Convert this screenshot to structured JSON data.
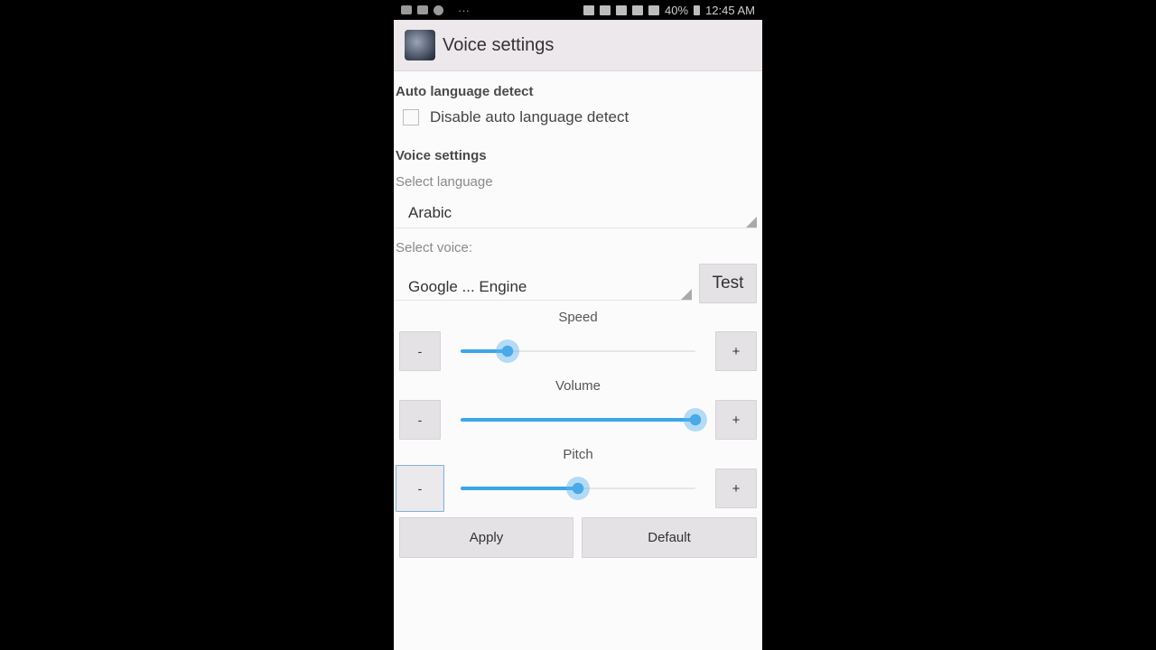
{
  "status_bar": {
    "battery": "40%",
    "time": "12:45 AM"
  },
  "app_bar": {
    "title": "Voice settings"
  },
  "auto_language": {
    "header": "Auto language detect",
    "checkbox_label": "Disable auto language detect",
    "checked": false
  },
  "voice": {
    "header": "Voice settings",
    "language_label": "Select language",
    "language_value": "Arabic",
    "voice_label": "Select voice:",
    "voice_value": "Google ... Engine",
    "test_label": "Test"
  },
  "sliders": {
    "speed": {
      "title": "Speed",
      "value": 0.2
    },
    "volume": {
      "title": "Volume",
      "value": 1.0
    },
    "pitch": {
      "title": "Pitch",
      "value": 0.5
    },
    "minus_label": "-",
    "plus_label": "+"
  },
  "actions": {
    "apply_label": "Apply",
    "default_label": "Default"
  },
  "colors": {
    "accent": "#3aa6e8",
    "app_bar": "#ede8ec",
    "button": "#e4e2e4"
  }
}
